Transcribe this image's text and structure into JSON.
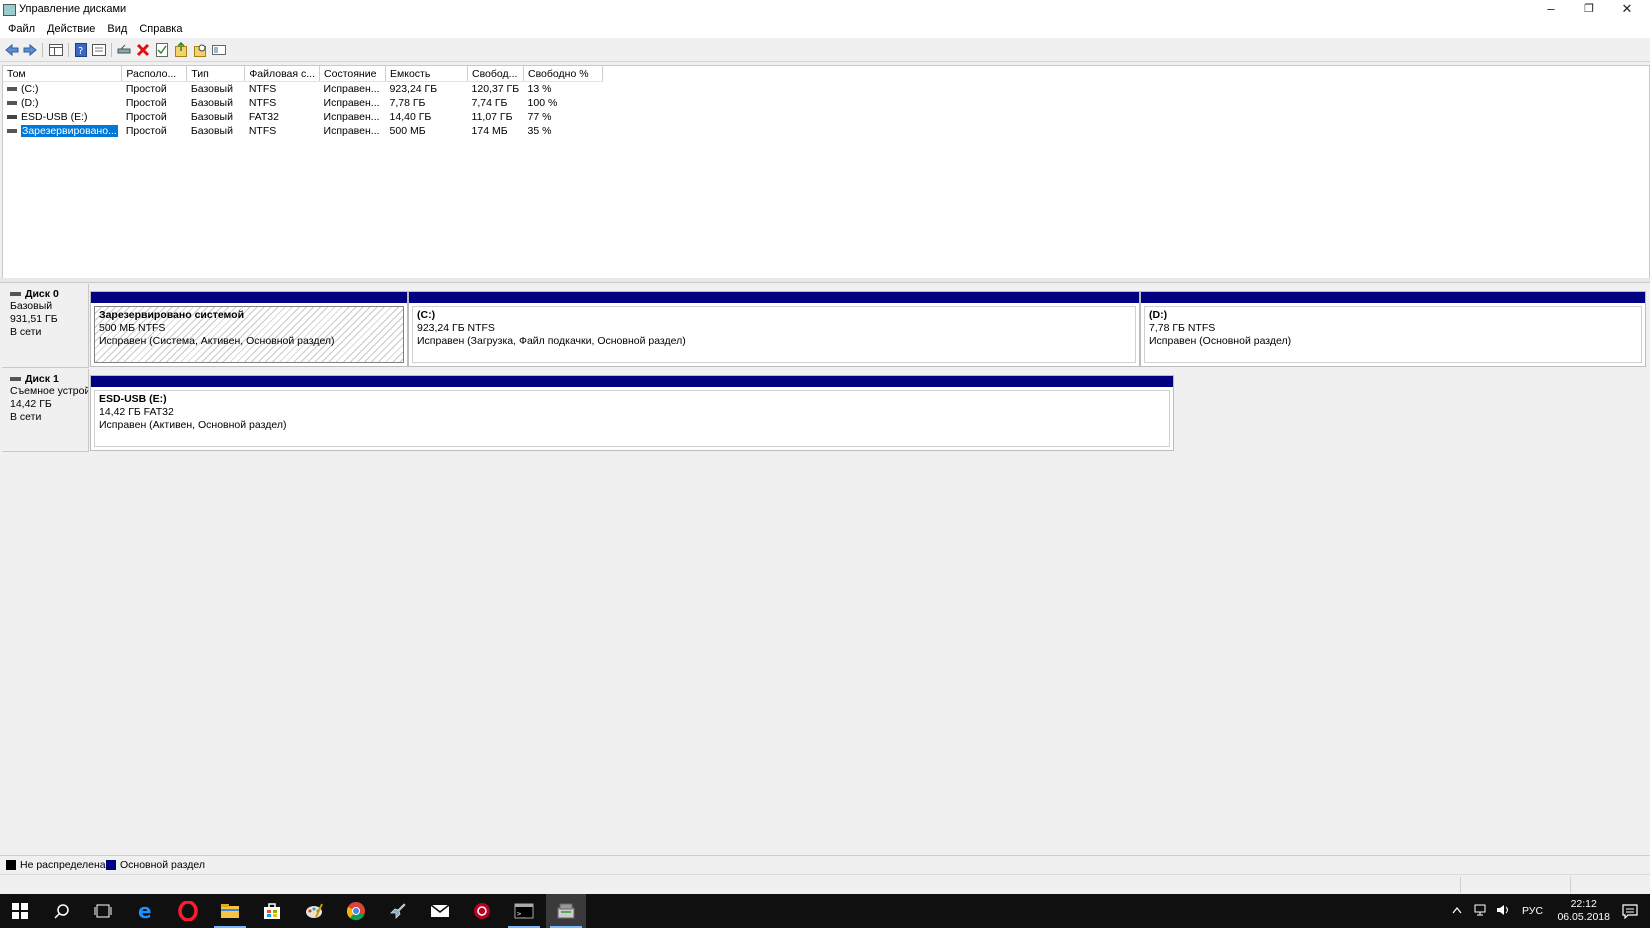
{
  "window": {
    "title": "Управление дисками",
    "min": "–",
    "restore": "❐",
    "close": "✕"
  },
  "menu": [
    "Файл",
    "Действие",
    "Вид",
    "Справка"
  ],
  "toolbar": [
    "back-icon",
    "forward-icon",
    "console-tree-icon",
    "help-icon",
    "properties-icon",
    "connect-icon",
    "delete-icon",
    "check-icon",
    "new-icon",
    "search-icon",
    "list-icon"
  ],
  "volumes": {
    "columns": [
      "Том",
      "Располо...",
      "Тип",
      "Файловая с...",
      "Состояние",
      "Емкость",
      "Свобод...",
      "Свободно %"
    ],
    "rows": [
      [
        "(C:)",
        "Простой",
        "Базовый",
        "NTFS",
        "Исправен...",
        "923,24 ГБ",
        "120,37 ГБ",
        "13 %"
      ],
      [
        "(D:)",
        "Простой",
        "Базовый",
        "NTFS",
        "Исправен...",
        "7,78 ГБ",
        "7,74 ГБ",
        "100 %"
      ],
      [
        "ESD-USB (E:)",
        "Простой",
        "Базовый",
        "FAT32",
        "Исправен...",
        "14,40 ГБ",
        "11,07 ГБ",
        "77 %"
      ],
      [
        "Зарезервировано...",
        "Простой",
        "Базовый",
        "NTFS",
        "Исправен...",
        "500 МБ",
        "174 МБ",
        "35 %"
      ]
    ]
  },
  "disks": [
    {
      "name": "Диск 0",
      "type": "Базовый",
      "size": "931,51 ГБ",
      "status": "В сети",
      "partitions": [
        {
          "name": "Зарезервировано системой",
          "size": "500 МБ NTFS",
          "status": "Исправен (Система, Активен, Основной раздел)"
        },
        {
          "name": "(C:)",
          "size": "923,24 ГБ NTFS",
          "status": "Исправен (Загрузка, Файл подкачки, Основной раздел)"
        },
        {
          "name": "(D:)",
          "size": "7,78 ГБ NTFS",
          "status": "Исправен (Основной раздел)"
        }
      ]
    },
    {
      "name": "Диск 1",
      "type": "Съемное устрой",
      "size": "14,42 ГБ",
      "status": "В сети",
      "partitions": [
        {
          "name": "ESD-USB  (E:)",
          "size": "14,42 ГБ FAT32",
          "status": "Исправен (Активен, Основной раздел)"
        }
      ]
    }
  ],
  "legend": [
    {
      "label": "Не распределена",
      "color": "#000000"
    },
    {
      "label": "Основной раздел",
      "color": "#000080"
    }
  ],
  "taskbar": {
    "apps": [
      "start-icon",
      "search-icon",
      "task-view-icon",
      "edge-icon",
      "opera-icon",
      "explorer-icon",
      "store-icon",
      "paint-icon",
      "chrome-icon",
      "rocket-icon",
      "mail-icon",
      "game-icon",
      "terminal-icon",
      "disk-mgmt-icon"
    ],
    "lang": "РУС",
    "time": "22:12",
    "date": "06.05.2018"
  }
}
